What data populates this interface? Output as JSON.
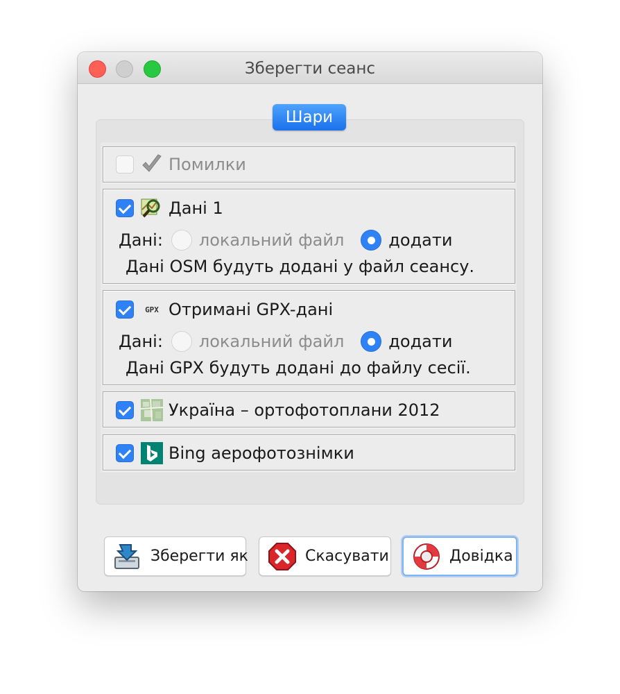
{
  "window": {
    "title": "Зберегти сеанс"
  },
  "group": {
    "tab_label": "Шари"
  },
  "layers": [
    {
      "label": "Помилки",
      "checked": false,
      "icon": "validator-check-icon"
    },
    {
      "label": "Дані 1",
      "checked": true,
      "icon": "osm-data-icon",
      "data_label": "Дані:",
      "option_local": "локальний файл",
      "option_add": "додати",
      "note": "Дані OSM будуть додані у файл сеансу."
    },
    {
      "label": "Отримані GPX-дані",
      "checked": true,
      "icon": "gpx-icon",
      "icon_text": "GPX",
      "data_label": "Дані:",
      "option_local": "локальний файл",
      "option_add": "додати",
      "note": "Дані GPX будуть додані до файлу сесії."
    },
    {
      "label": "Україна – ортофотоплани 2012",
      "checked": true,
      "icon": "imagery-icon"
    },
    {
      "label": "Bing аерофотознімки",
      "checked": true,
      "icon": "bing-icon"
    }
  ],
  "buttons": {
    "save_as": "Зберегти як",
    "cancel": "Скасувати",
    "help": "Довідка"
  },
  "colors": {
    "accent": "#2f82f6",
    "tab": "#1a71ec"
  }
}
